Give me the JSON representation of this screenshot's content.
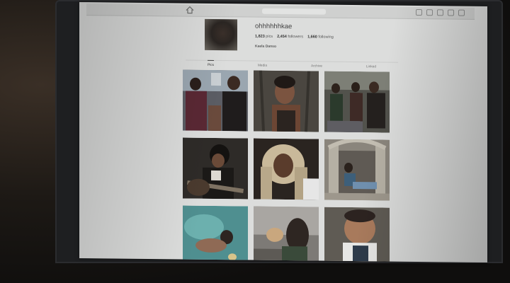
{
  "profile": {
    "username": "ohhhhhhkae",
    "posts_count": "1,823",
    "posts_label": "pics",
    "followers_count": "2,454",
    "followers_label": "followers",
    "following_count": "1,660",
    "following_label": "following",
    "full_name": "Kaela Danso"
  },
  "tabs": [
    {
      "label": "Pics",
      "active": true
    },
    {
      "label": "Media",
      "active": false
    },
    {
      "label": "Archive",
      "active": false
    },
    {
      "label": "Linked",
      "active": false
    }
  ],
  "colors": {
    "screen_bg": "#dcdddc",
    "bezel": "#1e1f21"
  },
  "photos": [
    {
      "icon": "group-photo"
    },
    {
      "icon": "portrait-photo"
    },
    {
      "icon": "party-photo"
    },
    {
      "icon": "guitar-photo"
    },
    {
      "icon": "braids-portrait-photo"
    },
    {
      "icon": "doorway-photo"
    },
    {
      "icon": "pool-photo"
    },
    {
      "icon": "sunset-photo"
    },
    {
      "icon": "baby-photo"
    }
  ]
}
